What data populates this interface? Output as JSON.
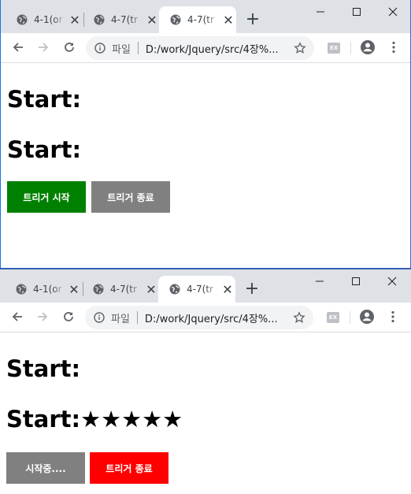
{
  "browser": {
    "tabs": [
      {
        "title": "4-1(or",
        "close": "✕"
      },
      {
        "title": "4-7(tr",
        "close": "✕"
      },
      {
        "title": "4-7(tr",
        "close": "✕",
        "active": true
      }
    ],
    "new_tab": "+",
    "omnibox": {
      "scheme_label": "파일",
      "url": "D:/work/Jquery/src/4장%..."
    },
    "extension_label": "EX",
    "icons": [
      "back-arrow-icon",
      "forward-arrow-icon",
      "reload-icon",
      "info-icon",
      "star-icon",
      "profile-icon",
      "kebab-menu-icon",
      "minimize-icon",
      "maximize-icon",
      "close-window-icon",
      "globe-icon"
    ]
  },
  "before": {
    "heading1": "Start:",
    "heading2": "Start:",
    "heading2_stars": "",
    "start_button": {
      "label": "트리거 시작",
      "color": "#008000"
    },
    "stop_button": {
      "label": "트리거 종료",
      "color": "#808080"
    }
  },
  "after": {
    "heading1": "Start:",
    "heading2": "Start:",
    "heading2_stars": "★★★★★",
    "start_button": {
      "label": "시작중....",
      "color": "#808080"
    },
    "stop_button": {
      "label": "트리거 종료",
      "color": "#ff0000"
    }
  }
}
